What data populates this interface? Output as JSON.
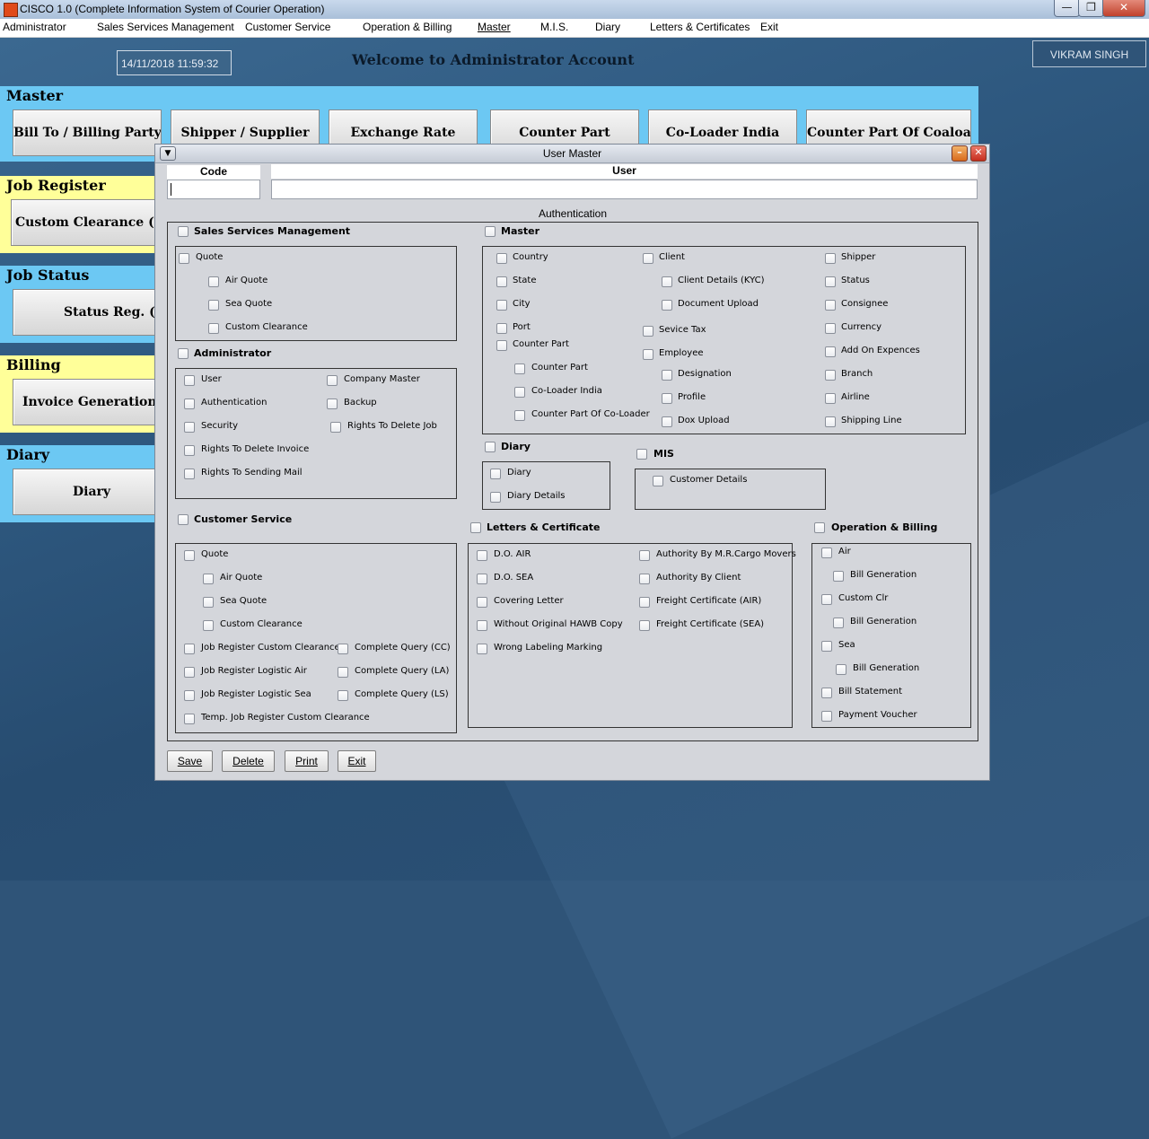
{
  "window": {
    "title": "CISCO 1.0 (Complete Information System of Courier Operation)",
    "min": "—",
    "max": "❐",
    "close": "✕"
  },
  "menu": [
    "Administrator",
    "Sales Services Management",
    "Customer Service",
    "Operation & Billing",
    "Master",
    "M.I.S.",
    "Diary",
    "Letters & Certificates",
    "Exit"
  ],
  "header": {
    "datetime": "14/11/2018     11:59:32",
    "welcome": "Welcome to Administrator Account",
    "user": "VIKRAM SINGH"
  },
  "master_panel": {
    "title": "Master",
    "buttons": [
      "Bill To / Billing Party",
      "Shipper / Supplier",
      "Exchange Rate",
      "Counter Part",
      "Co-Loader India",
      "Counter Part Of Coaloader"
    ]
  },
  "side_panels": [
    {
      "title": "Job Register",
      "button": "Custom Clearance (Temp"
    },
    {
      "title": "Job Status",
      "button": "Status Reg. (All)"
    },
    {
      "title": "Billing",
      "button": "Invoice Generation (Cu"
    },
    {
      "title": "Diary",
      "button": "Diary"
    }
  ],
  "dialog": {
    "title": "User Master",
    "code_label": "Code",
    "user_label": "User",
    "code_value": "",
    "user_value": "",
    "auth_label": "Authentication",
    "buttons": {
      "save": "Save",
      "delete": "Delete",
      "print": "Print",
      "exit": "Exit"
    }
  },
  "groups": {
    "ssm": {
      "title": "Sales Services Management",
      "items": [
        "Quote",
        "Air Quote",
        "Sea Quote",
        "Custom Clearance"
      ]
    },
    "admin": {
      "title": "Administrator",
      "items": [
        "User",
        "Authentication",
        "Security",
        "Rights To Delete Invoice",
        "Rights To Sending Mail",
        "Company Master",
        "Backup",
        "Rights To Delete Job"
      ]
    },
    "cs": {
      "title": "Customer Service",
      "items": [
        "Quote",
        "Air Quote",
        "Sea Quote",
        "Custom Clearance",
        "Job Register Custom Clearance",
        "Job Register Logistic Air",
        "Job Register Logistic Sea",
        "Temp. Job Register Custom Clearance",
        "Complete Query (CC)",
        "Complete Query (LA)",
        "Complete Query (LS)"
      ]
    },
    "master": {
      "title": "Master",
      "items": [
        "Country",
        "State",
        "City",
        "Port",
        "Counter Part",
        "Counter Part",
        "Co-Loader India",
        "Counter Part Of Co-Loader",
        "Client",
        "Client Details (KYC)",
        "Document Upload",
        "Sevice Tax",
        "Employee",
        "Designation",
        "Profile",
        "Dox Upload",
        "Shipper",
        "Status",
        "Consignee",
        "Currency",
        "Add On Expences",
        "Branch",
        "Airline",
        "Shipping Line"
      ]
    },
    "diary": {
      "title": "Diary",
      "items": [
        "Diary",
        "Diary Details"
      ]
    },
    "mis": {
      "title": "MIS",
      "items": [
        "Customer Details"
      ]
    },
    "letters": {
      "title": "Letters & Certificate",
      "items": [
        "D.O. AIR",
        "D.O. SEA",
        "Covering Letter",
        "Without Original HAWB Copy",
        "Wrong Labeling Marking",
        "Authority By M.R.Cargo Movers",
        "Authority By Client",
        "Freight Certificate (AIR)",
        "Freight Certificate (SEA)"
      ]
    },
    "ob": {
      "title": "Operation & Billing",
      "items": [
        "Air",
        "Bill Generation",
        "Custom Clr",
        "Bill Generation",
        "Sea",
        "Bill Generation",
        "Bill Statement",
        "Payment Voucher"
      ]
    }
  }
}
